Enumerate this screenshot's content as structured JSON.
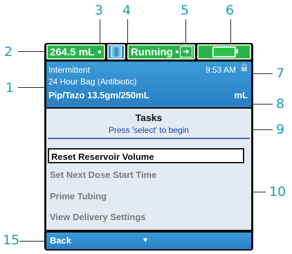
{
  "callouts": [
    "1",
    "2",
    "3",
    "4",
    "5",
    "6",
    "7",
    "8",
    "9",
    "10",
    "15"
  ],
  "status_bar": {
    "volume": "264.5 mL",
    "state": "Running",
    "bag_icon": "iv-bag-icon",
    "arrow_icon": "forward-arrow-icon",
    "battery_icon": "battery-icon"
  },
  "info": {
    "mode": "Intermittent",
    "time": "9:53 AM",
    "lock_icon": "lock-icon",
    "bag_name": "24 Hour Bag (Antibiotic)",
    "drug": "Pip/Tazo 13.5gm/250mL",
    "unit": "mL"
  },
  "tasks": {
    "title": "Tasks",
    "prompt": "Press 'select' to begin",
    "items": [
      "Reset Reservoir Volume",
      "Set Next Dose Start Time",
      "Prime Tubing",
      "View Delivery Settings"
    ]
  },
  "bottom_bar": {
    "back_label": "Back",
    "scroll_icon": "chevron-down-icon"
  },
  "colors": {
    "callout": "#1a9bb8",
    "status_green": "#27b34b",
    "info_blue": "#2b7fc4",
    "list_bg": "#e4eaf2",
    "prompt_blue": "#1f3ea8"
  }
}
